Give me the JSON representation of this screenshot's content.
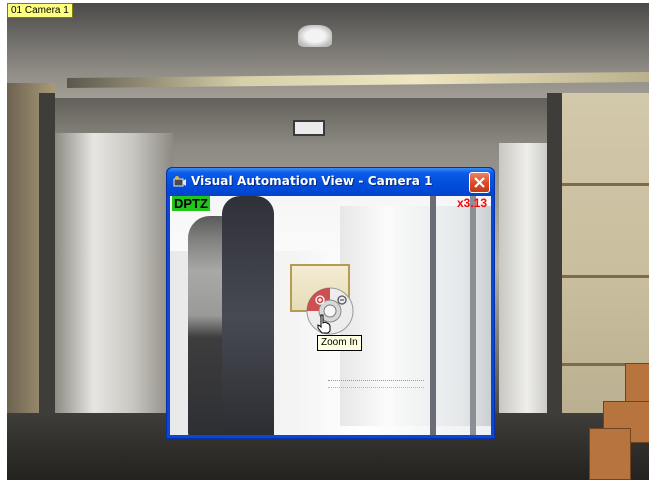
{
  "camera": {
    "label": "01 Camera 1"
  },
  "window": {
    "title": "Visual Automation View - Camera 1",
    "mode_badge": "DPTZ",
    "zoom_level": "x3.13",
    "close_icon": "close-icon",
    "app_icon": "camera-app-icon"
  },
  "ptz_control": {
    "icon": "ptz-zoom-wheel-icon",
    "tooltip": "Zoom In",
    "cursor_icon": "hand-pointer-icon"
  },
  "colors": {
    "title_bar": "#0450dd",
    "close_button": "#d94a22",
    "mode_badge_bg": "#22c51c",
    "zoom_level_text": "#ff0000",
    "camera_label_bg": "#ffff80"
  }
}
